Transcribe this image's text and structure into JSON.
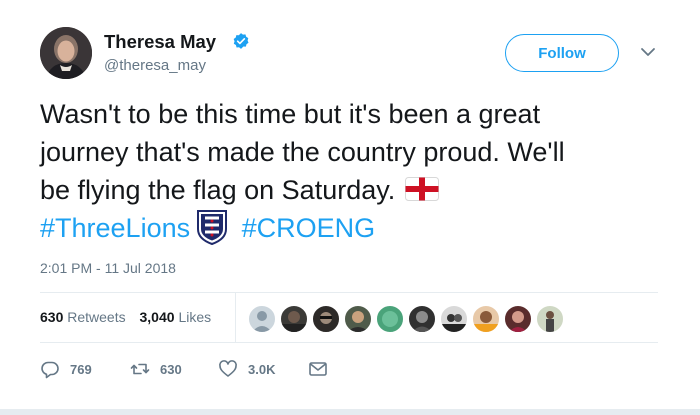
{
  "author": {
    "name": "Theresa May",
    "handle": "@theresa_may"
  },
  "follow_label": "Follow",
  "tweet": {
    "line1": "Wasn't to be this time but it's been a great",
    "line2": "journey that's made the country proud. We'll",
    "line3": "be flying the flag on Saturday.",
    "hashtag1": "#ThreeLions",
    "hashtag2": "#CROENG"
  },
  "timestamp": "2:01 PM - 11 Jul 2018",
  "stats": {
    "retweets_count": "630",
    "retweets_label": "Retweets",
    "likes_count": "3,040",
    "likes_label": "Likes"
  },
  "actions": {
    "replies": "769",
    "retweets": "630",
    "likes": "3.0K"
  },
  "colors": {
    "accent": "#1da1f2",
    "text": "#14171a",
    "secondary": "#657786",
    "divider": "#e6ecf0"
  },
  "icons": [
    "verified-badge-icon",
    "chevron-down-icon",
    "england-flag-icon",
    "three-lions-crest-icon",
    "reply-icon",
    "retweet-icon",
    "heart-icon",
    "direct-message-icon"
  ]
}
